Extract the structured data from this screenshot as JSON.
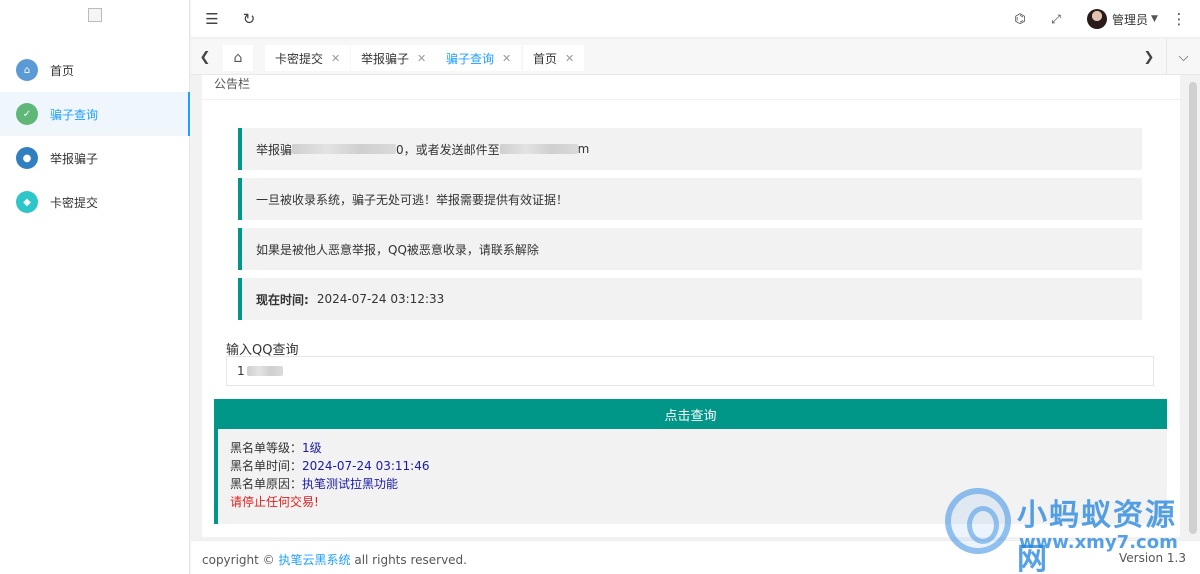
{
  "sidebar": {
    "items": [
      {
        "label": "首页",
        "icon": "home-icon",
        "color": "#5b9bd5"
      },
      {
        "label": "骗子查询",
        "icon": "shield-check-icon",
        "color": "#5fb878"
      },
      {
        "label": "举报骗子",
        "icon": "report-icon",
        "color": "#2f7fc1"
      },
      {
        "label": "卡密提交",
        "icon": "cube-icon",
        "color": "#2ec7c9"
      }
    ]
  },
  "header": {
    "user_name": "管理员"
  },
  "tabs": [
    {
      "label": "卡密提交"
    },
    {
      "label": "举报骗子"
    },
    {
      "label": "骗子查询"
    },
    {
      "label": "首页"
    }
  ],
  "notice": {
    "title": "公告栏",
    "line1_prefix": "举报骗",
    "line1_mid": "0，或者发送邮件至",
    "line1_suffix": "m",
    "line2": "一旦被收录系统，骗子无处可逃！举报需要提供有效证据！",
    "line3": "如果是被他人恶意举报，QQ被恶意收录，请联系解除",
    "time_label": "现在时间:",
    "time_value": "2024-07-24 03:12:33"
  },
  "query": {
    "label": "输入QQ查询",
    "value_prefix": "1",
    "button": "点击查询"
  },
  "result": {
    "level_label": "黑名单等级：",
    "level_value": "1级",
    "time_label": "黑名单时间：",
    "time_value": "2024-07-24 03:11:46",
    "reason_label": "黑名单原因：",
    "reason_value": "执笔测试拉黑功能",
    "warning": "请停止任何交易!"
  },
  "footer": {
    "copy_prefix": "copyright ©",
    "copy_link": "执笔云黑系统",
    "copy_suffix": "all rights reserved.",
    "version": "Version 1.3"
  },
  "watermark": {
    "cn": "小蚂蚁资源网",
    "en": "www.xmy7.com"
  },
  "colors": {
    "accent": "#009688",
    "active": "#1e9fff"
  }
}
